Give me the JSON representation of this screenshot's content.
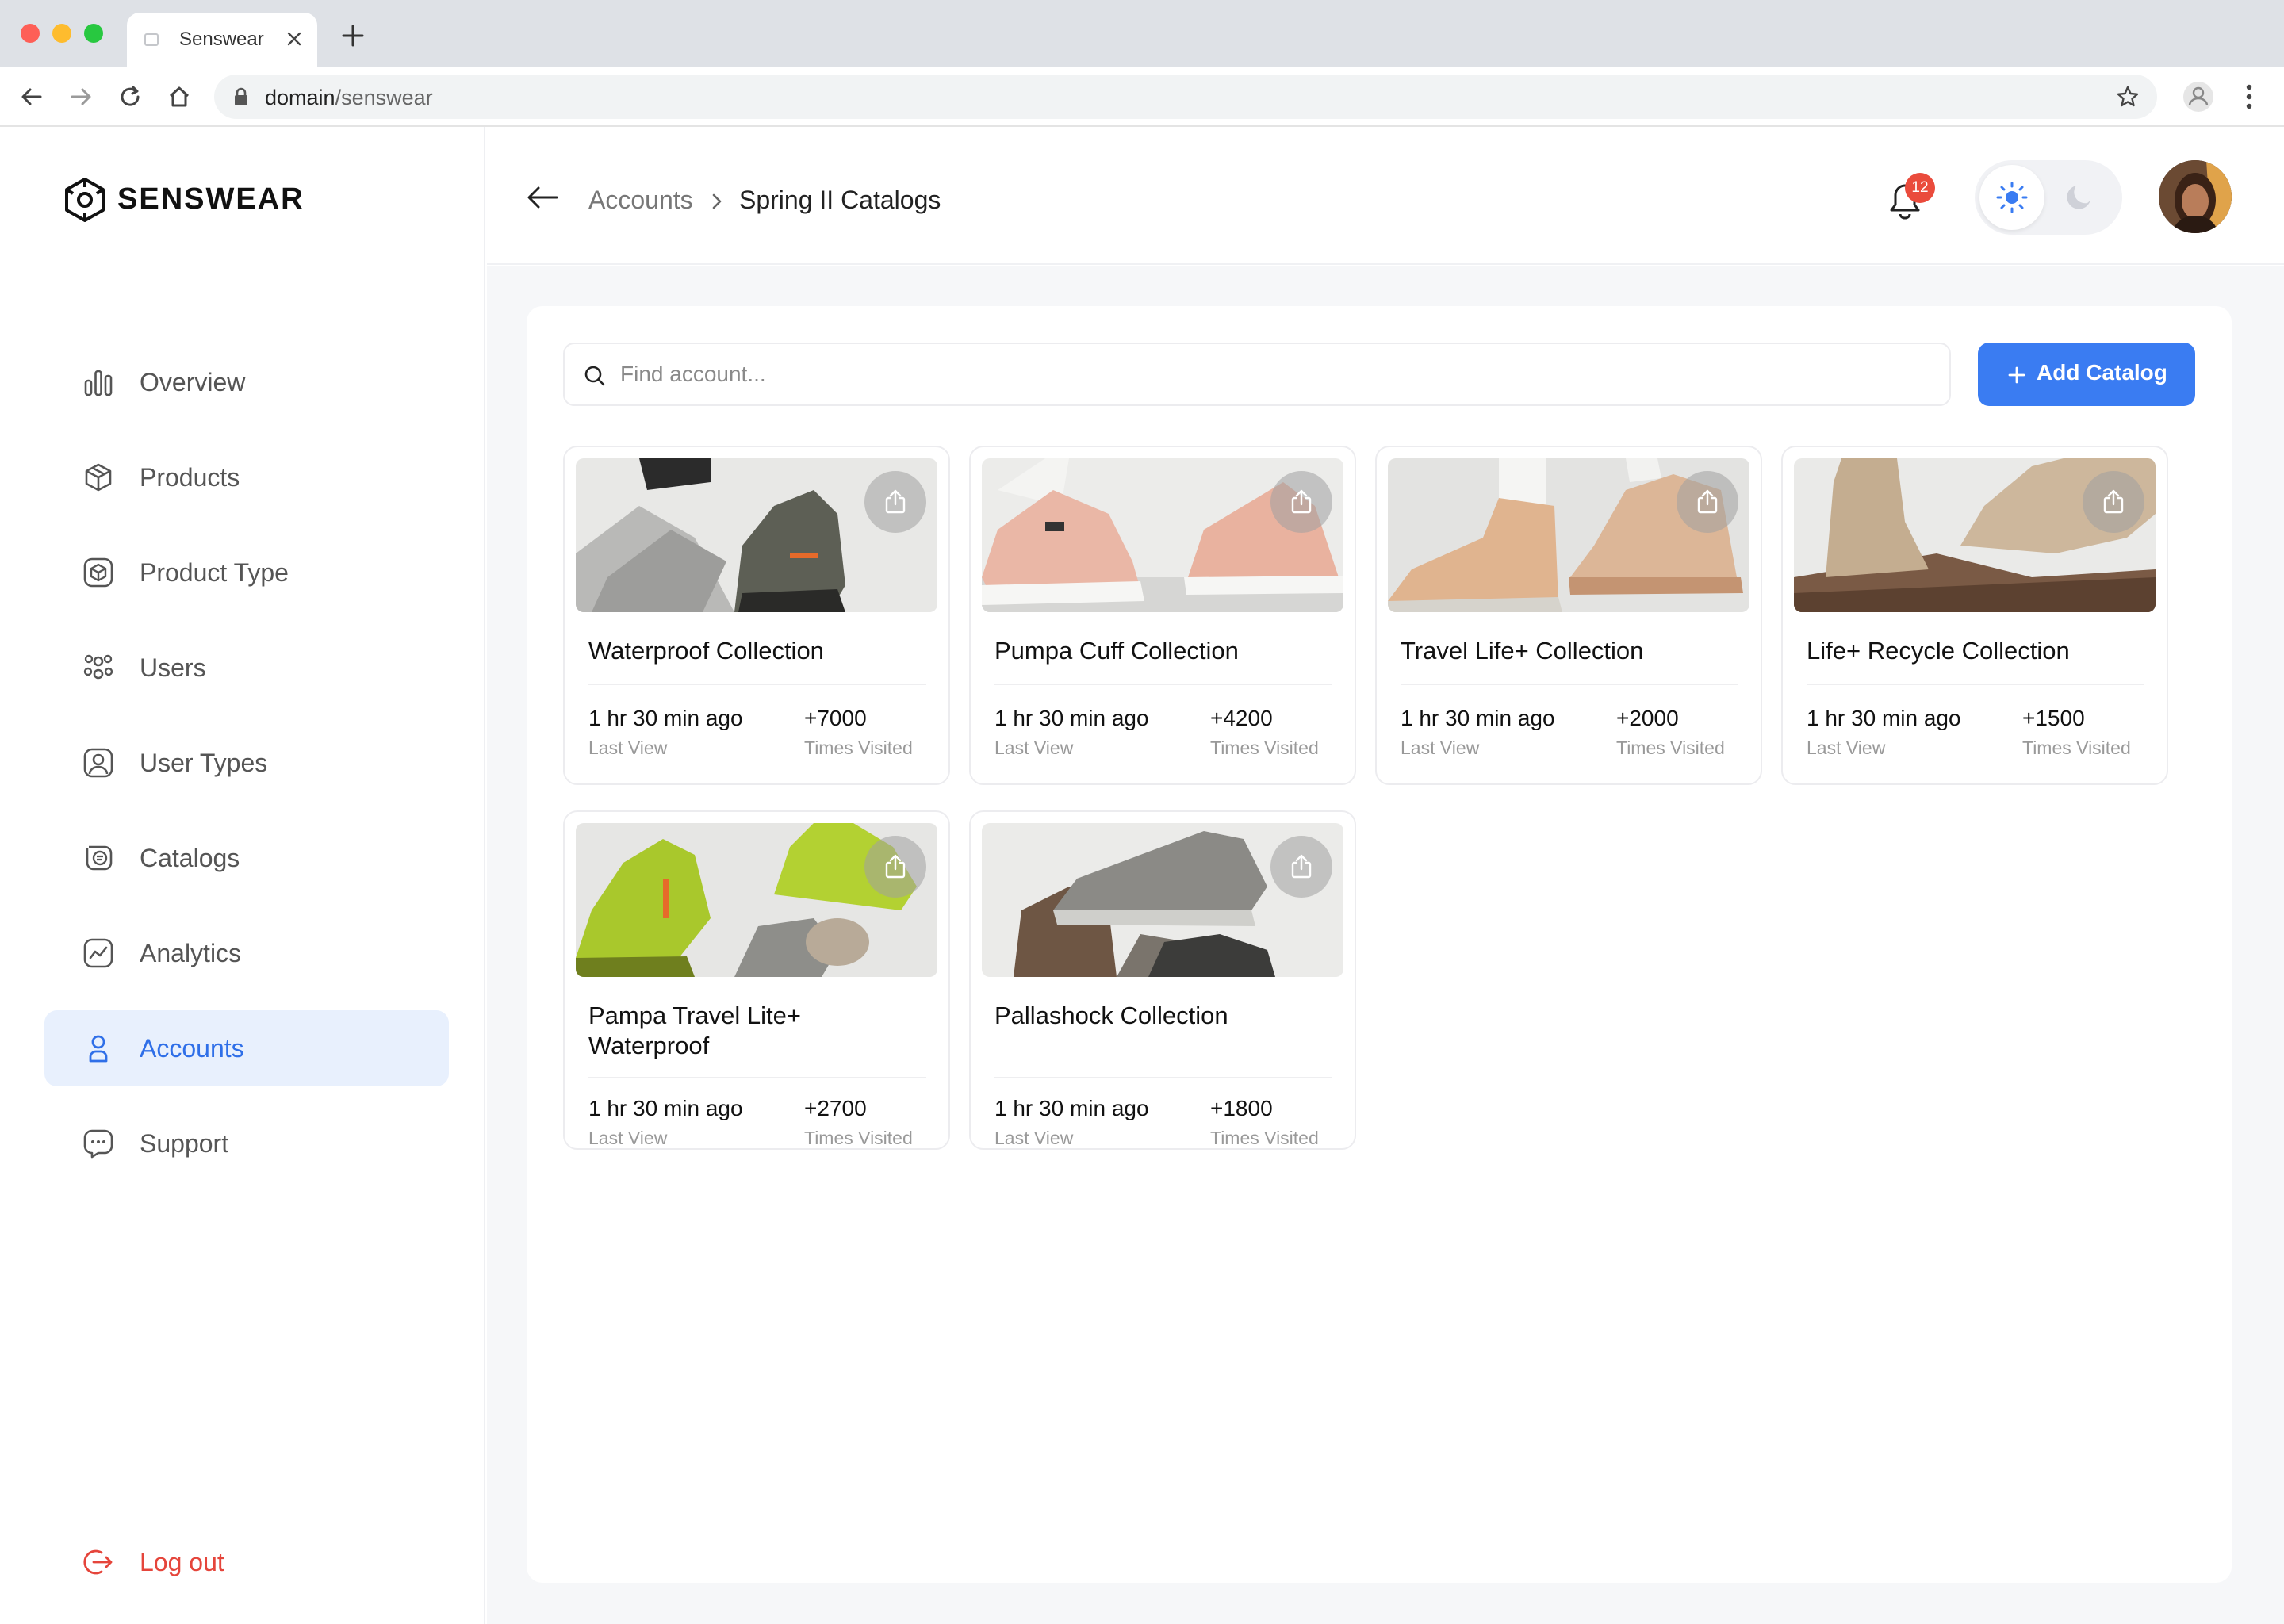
{
  "browser": {
    "tab_title": "Senswear",
    "url_domain": "domain",
    "url_path": "/senswear"
  },
  "sidebar": {
    "logo_text": "SENSWEAR",
    "items": [
      {
        "label": "Overview",
        "icon": "bar-chart-icon"
      },
      {
        "label": "Products",
        "icon": "box-icon"
      },
      {
        "label": "Product Type",
        "icon": "box-square-icon"
      },
      {
        "label": "Users",
        "icon": "users-icon"
      },
      {
        "label": "User Types",
        "icon": "user-square-icon"
      },
      {
        "label": "Catalogs",
        "icon": "catalog-icon"
      },
      {
        "label": "Analytics",
        "icon": "analytics-icon"
      },
      {
        "label": "Accounts",
        "icon": "user-icon",
        "active": true
      },
      {
        "label": "Support",
        "icon": "chat-icon"
      }
    ],
    "logout_label": "Log out"
  },
  "header": {
    "breadcrumb_parent": "Accounts",
    "breadcrumb_current": "Spring II Catalogs",
    "notification_count": "12"
  },
  "main": {
    "search_placeholder": "Find account...",
    "add_button_label": "Add Catalog",
    "cards": [
      {
        "title": "Waterproof Collection",
        "last_view": "1 hr 30 min ago",
        "last_view_label": "Last View",
        "visits": "+7000",
        "visits_label": "Times Visited"
      },
      {
        "title": "Pumpa Cuff Collection",
        "last_view": "1 hr 30 min ago",
        "last_view_label": "Last View",
        "visits": "+4200",
        "visits_label": "Times Visited"
      },
      {
        "title": "Travel Life+ Collection",
        "last_view": "1 hr 30 min ago",
        "last_view_label": "Last View",
        "visits": "+2000",
        "visits_label": "Times Visited"
      },
      {
        "title": "Life+ Recycle Collection",
        "last_view": "1 hr 30 min ago",
        "last_view_label": "Last View",
        "visits": "+1500",
        "visits_label": "Times Visited"
      },
      {
        "title": "Pampa Travel Lite+ Waterproof",
        "last_view": "1 hr 30 min ago",
        "last_view_label": "Last View",
        "visits": "+2700",
        "visits_label": "Times Visited"
      },
      {
        "title": "Pallashock Collection",
        "last_view": "1 hr 30 min ago",
        "last_view_label": "Last View",
        "visits": "+1800",
        "visits_label": "Times Visited"
      }
    ]
  },
  "colors": {
    "accent": "#3a7cf2",
    "active_bg": "#e8f0fd",
    "danger": "#e5453b",
    "badge": "#ea4b3c"
  }
}
